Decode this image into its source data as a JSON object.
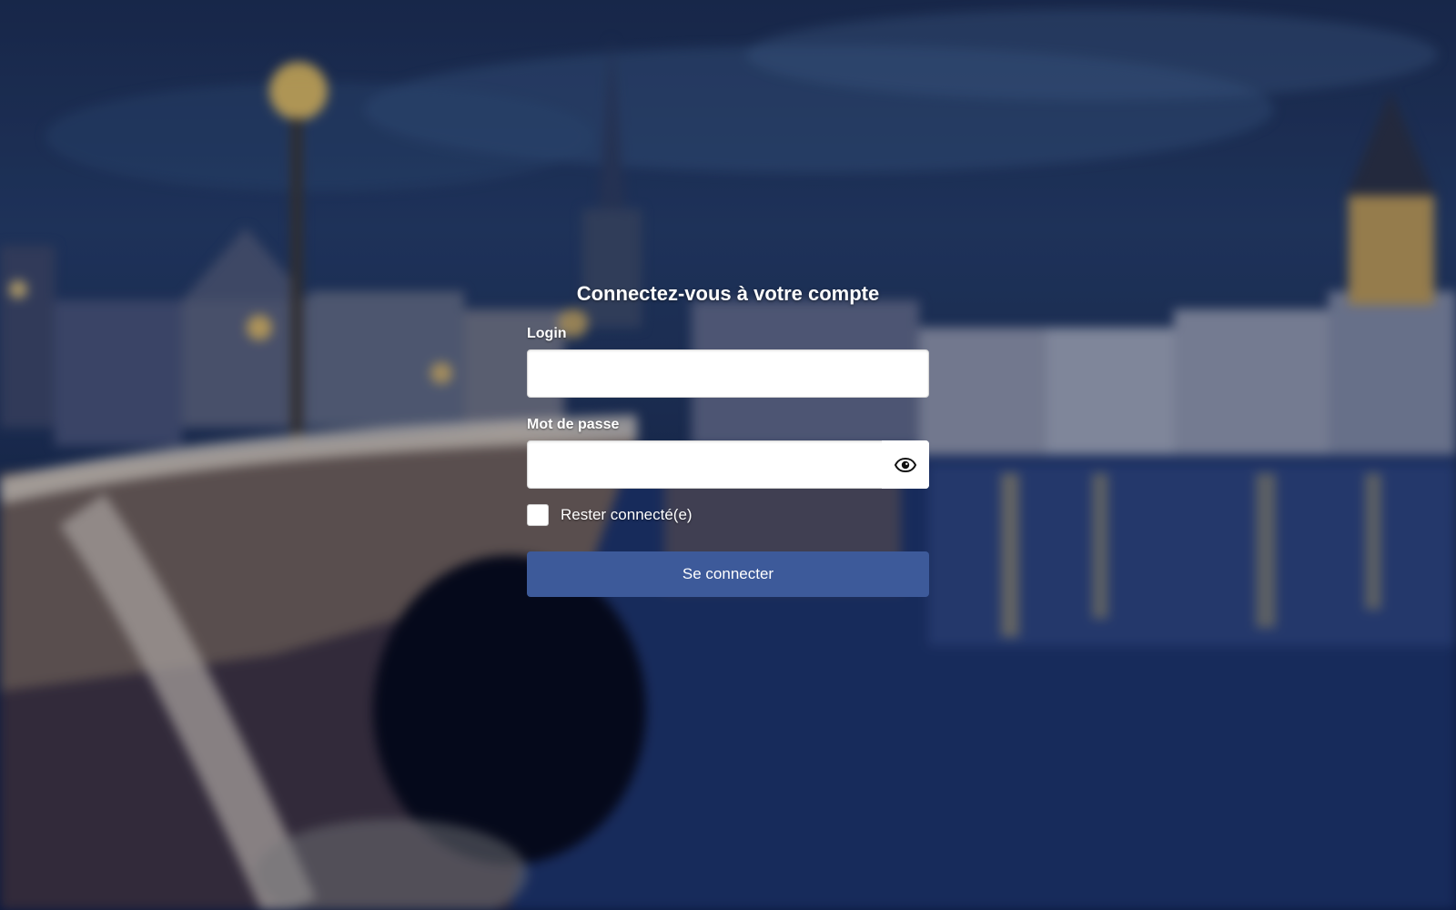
{
  "login_form": {
    "title": "Connectez-vous à votre compte",
    "login_label": "Login",
    "login_value": "",
    "password_label": "Mot de passe",
    "password_value": "",
    "password_toggle_icon": "eye-icon",
    "remember_label": "Rester connecté(e)",
    "remember_checked": false,
    "submit_label": "Se connecter"
  },
  "colors": {
    "button_background": "#3d5a9a",
    "text_on_background": "#ffffff",
    "input_background": "#ffffff"
  },
  "background_image": {
    "subject": "blurred night city riverside with bridge and church towers"
  }
}
